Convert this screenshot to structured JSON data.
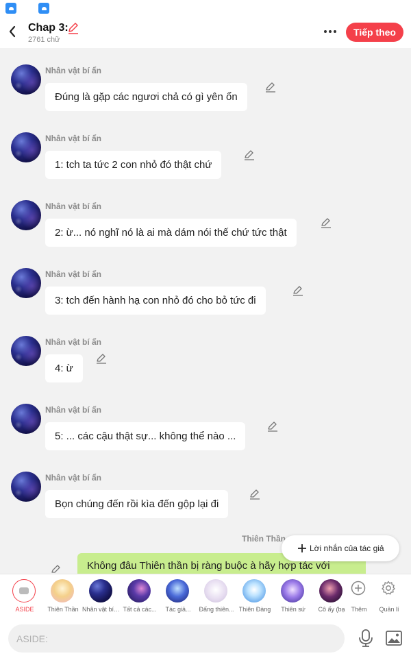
{
  "header": {
    "chapter_title": "Chap 3:",
    "word_count": "2761 chữ",
    "next_label": "Tiếp theo"
  },
  "messages": [
    {
      "sender": "Nhân vật bí ẩn",
      "text": "Đúng là gặp các ngươi chả có gì yên ổn"
    },
    {
      "sender": "Nhân vật bí ẩn",
      "text": "1: tch ta tức 2 con nhỏ đó thật chứ"
    },
    {
      "sender": "Nhân vật bí ẩn",
      "text": "2: ừ... nó nghĩ nó là ai mà dám nói thế chứ tức thật"
    },
    {
      "sender": "Nhân vật bí ẩn",
      "text": "3: tch đến hành hạ con nhỏ đó cho bỏ tức đi"
    },
    {
      "sender": "Nhân vật bí ẩn",
      "text": "4: ừ"
    },
    {
      "sender": "Nhân vật bí ẩn",
      "text": "5: ... các cậu thật sự... không thể nào ..."
    },
    {
      "sender": "Nhân vật bí ẩn",
      "text": "Bọn chúng đến rồi kìa đến gộp lại đi"
    }
  ],
  "right_message": {
    "sender": "Thiên Thần",
    "text": "Không đâu Thiên thần bị ràng buộc à hãy hợp tác với"
  },
  "author_note": {
    "label": "Lời nhắn của tác giả"
  },
  "characters": [
    {
      "label": "ASIDE"
    },
    {
      "label": "Thiên Thần"
    },
    {
      "label": "Nhân vật bí ẩn"
    },
    {
      "label": "Tất cả các..."
    },
    {
      "label": "Tác giả..."
    },
    {
      "label": "Đấng thiên..."
    },
    {
      "label": "Thiên Đàng"
    },
    {
      "label": "Thiên sứ"
    },
    {
      "label": "Cô ấy (bạ"
    }
  ],
  "tools": {
    "more_label": "Thêm",
    "manage_label": "Quản lí"
  },
  "input": {
    "placeholder": "ASIDE:"
  },
  "colors": {
    "accent": "#f4404a",
    "right_bubble": "#c8ed8e",
    "background": "#f2f2f2"
  }
}
